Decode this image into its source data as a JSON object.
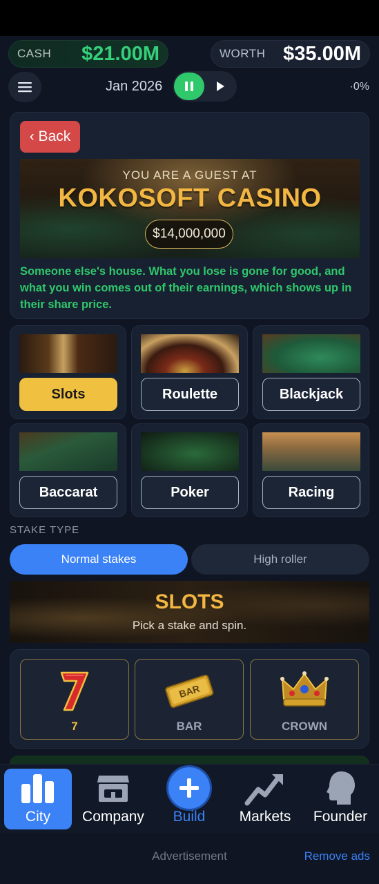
{
  "header": {
    "cash_label": "CASH",
    "cash_value": "$21.00M",
    "worth_label": "WORTH",
    "worth_value": "$35.00M",
    "date": "Jan 2026",
    "change": "·0%",
    "menu_icon": "hamburger-icon",
    "pause_icon": "pause-icon",
    "play_icon": "play-icon"
  },
  "casino": {
    "back_label": "‹ Back",
    "guest_line": "YOU ARE A GUEST AT",
    "name": "KOKOSOFT CASINO",
    "amount": "$14,000,000",
    "note": "Someone else's house. What you lose is gone for good, and what you win comes out of their earnings, which shows up in their share price."
  },
  "games": [
    {
      "label": "Slots",
      "active": true
    },
    {
      "label": "Roulette",
      "active": false
    },
    {
      "label": "Blackjack",
      "active": false
    },
    {
      "label": "Baccarat",
      "active": false
    },
    {
      "label": "Poker",
      "active": false
    },
    {
      "label": "Racing",
      "active": false
    }
  ],
  "stake": {
    "label": "STAKE TYPE",
    "options": [
      "Normal stakes",
      "High roller"
    ],
    "selected": "Normal stakes"
  },
  "slots": {
    "title": "SLOTS",
    "subtitle": "Pick a stake and spin.",
    "reels": [
      {
        "label": "7",
        "icon": "seven-icon"
      },
      {
        "label": "BAR",
        "icon": "bar-icon"
      },
      {
        "label": "CROWN",
        "icon": "crown-icon"
      }
    ]
  },
  "nav": {
    "items": [
      {
        "label": "City",
        "icon": "city-icon",
        "active": true
      },
      {
        "label": "Company",
        "icon": "storefront-icon",
        "active": false
      },
      {
        "label": "Build",
        "icon": "plus-icon",
        "active": false
      },
      {
        "label": "Markets",
        "icon": "trend-up-icon",
        "active": false
      },
      {
        "label": "Founder",
        "icon": "person-head-icon",
        "active": false
      }
    ]
  },
  "ads": {
    "text": "Advertisement",
    "remove": "Remove ads"
  },
  "colors": {
    "accent_blue": "#3b82f6",
    "cash_green": "#35d07a",
    "gold": "#f0c040",
    "back_red": "#d44848",
    "background": "#0f1522"
  }
}
